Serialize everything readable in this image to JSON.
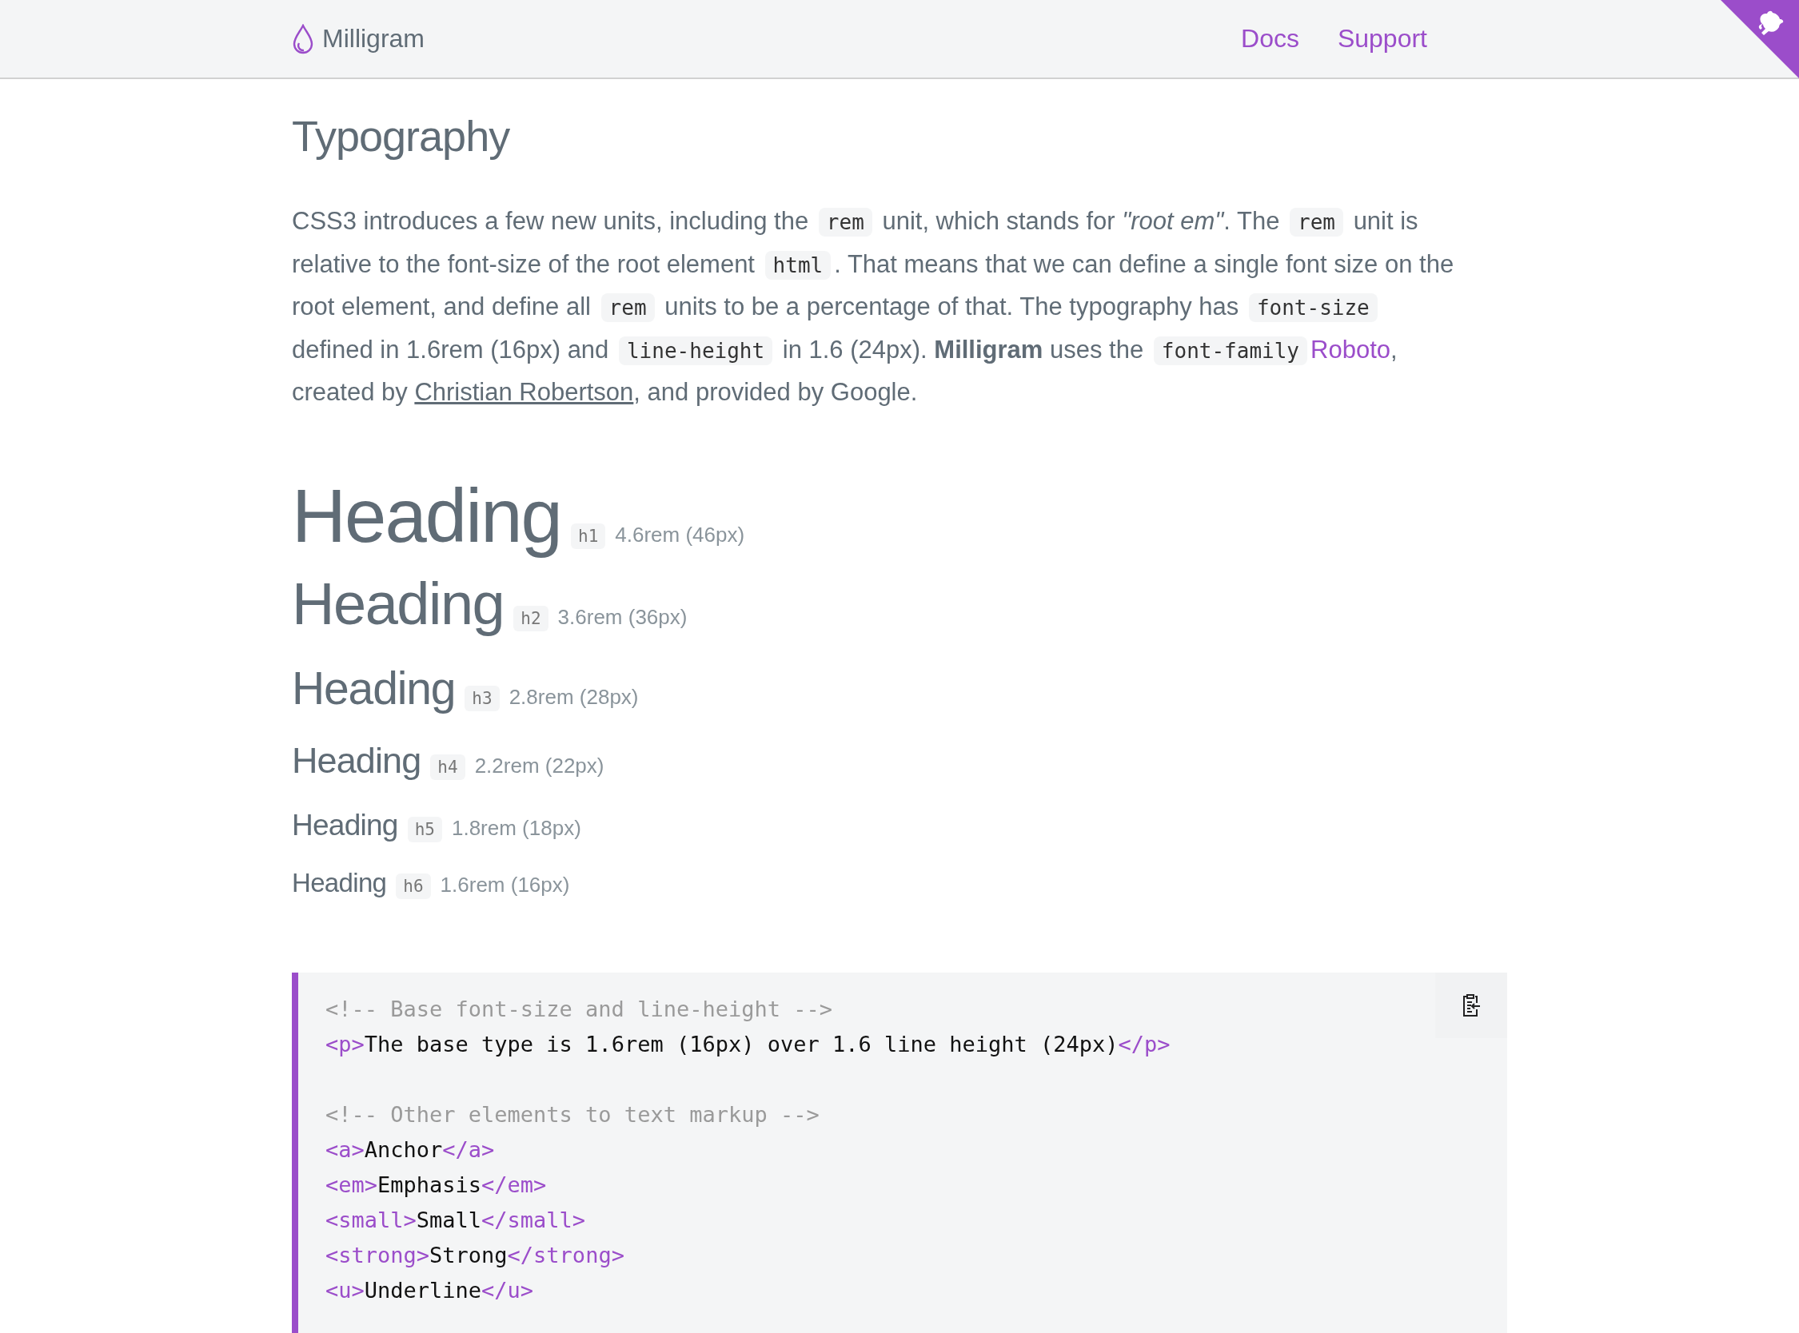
{
  "header": {
    "logo": "Milligram",
    "nav": [
      {
        "label": "Docs"
      },
      {
        "label": "Support"
      }
    ]
  },
  "title": "Typography",
  "intro": [
    {
      "kind": "text",
      "text": "CSS3 introduces a few new units, including the "
    },
    {
      "kind": "code",
      "text": "rem"
    },
    {
      "kind": "text",
      "text": " unit, which stands for *\"root em\"*. The "
    },
    {
      "kind": "code",
      "text": "rem"
    },
    {
      "kind": "text",
      "text": " unit is relative to the font-size of the root element "
    },
    {
      "kind": "code",
      "text": "html"
    },
    {
      "kind": "text",
      "text": ". That means that we can define a single font size on the root element, and define all "
    },
    {
      "kind": "code",
      "text": "rem"
    },
    {
      "kind": "text",
      "text": " units to be a percentage of that. The typography has "
    },
    {
      "kind": "code",
      "text": "font-size"
    },
    {
      "kind": "text",
      "text": " defined in 1.6rem (16px) and "
    },
    {
      "kind": "code",
      "text": "line-height"
    },
    {
      "kind": "text",
      "text": " in 1.6 (24px). **Milligram** uses the "
    },
    {
      "kind": "code",
      "text": "font-family"
    },
    {
      "kind": "link",
      "text": "Roboto"
    },
    {
      "kind": "text",
      "text": ", created by "
    },
    {
      "kind": "underline-link",
      "text": "Christian Robertson"
    },
    {
      "kind": "text",
      "text": ", and provided by Google."
    }
  ],
  "headings": [
    {
      "kind": "h1",
      "text": "Heading",
      "tag": "h1",
      "note": "4.6rem (46px)"
    },
    {
      "kind": "h2",
      "text": "Heading",
      "tag": "h2",
      "note": "3.6rem (36px)"
    },
    {
      "kind": "h3",
      "text": "Heading",
      "tag": "h3",
      "note": "2.8rem (28px)"
    },
    {
      "kind": "h4",
      "text": "Heading",
      "tag": "h4",
      "note": "2.2rem (22px)"
    },
    {
      "kind": "h5",
      "text": "Heading",
      "tag": "h5",
      "note": "1.8rem (18px)"
    },
    {
      "kind": "h6",
      "text": "Heading",
      "tag": "h6",
      "note": "1.6rem (16px)"
    }
  ],
  "code": {
    "blocks": [
      {
        "lines": [
          [
            {
              "kind": "comment",
              "text": "<!-- Base font-size and line-height -->"
            }
          ],
          [
            {
              "kind": "tag",
              "text": "<p>"
            },
            {
              "kind": "text",
              "text": "The base type is 1.6rem (16px) over 1.6 line height (24px)"
            },
            {
              "kind": "tag",
              "text": "</p>"
            }
          ]
        ]
      },
      {
        "lines": [
          [
            {
              "kind": "comment",
              "text": "<!-- Other elements to text markup -->"
            }
          ],
          [
            {
              "kind": "tag",
              "text": "<a>"
            },
            {
              "kind": "text",
              "text": "Anchor"
            },
            {
              "kind": "tag",
              "text": "</a>"
            }
          ],
          [
            {
              "kind": "tag",
              "text": "<em>"
            },
            {
              "kind": "text",
              "text": "Emphasis"
            },
            {
              "kind": "tag",
              "text": "</em>"
            }
          ],
          [
            {
              "kind": "tag",
              "text": "<small>"
            },
            {
              "kind": "text",
              "text": "Small"
            },
            {
              "kind": "tag",
              "text": "</small>"
            }
          ],
          [
            {
              "kind": "tag",
              "text": "<strong>"
            },
            {
              "kind": "text",
              "text": "Strong"
            },
            {
              "kind": "tag",
              "text": "</strong>"
            }
          ],
          [
            {
              "kind": "tag",
              "text": "<u>"
            },
            {
              "kind": "text",
              "text": "Underline"
            },
            {
              "kind": "tag",
              "text": "</u>"
            }
          ]
        ]
      }
    ]
  }
}
